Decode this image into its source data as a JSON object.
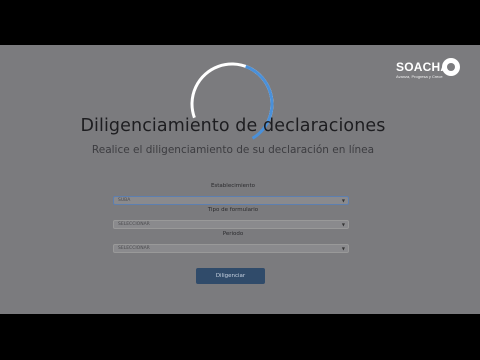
{
  "brand": {
    "name": "SOACHA",
    "tagline": "Avanza, Progresa y Crece"
  },
  "page": {
    "title": "Diligenciamiento de declaraciones",
    "subtitle": "Realice el diligenciamiento de su declaración en línea"
  },
  "form": {
    "fields": [
      {
        "label": "Establecimiento",
        "value": "SUBA"
      },
      {
        "label": "Tipo de formulario",
        "value": "SELECCIONAR"
      },
      {
        "label": "Periodo",
        "value": "SELECCIONAR"
      }
    ],
    "submit_label": "Diligenciar"
  },
  "colors": {
    "spinner": "#4a90d9",
    "button": "#304b6a",
    "overlay": "#7b7b7e"
  },
  "icons": {
    "spinner": "loading-spinner-icon",
    "caret": "caret-down-icon",
    "logo": "soacha-logo-icon"
  }
}
